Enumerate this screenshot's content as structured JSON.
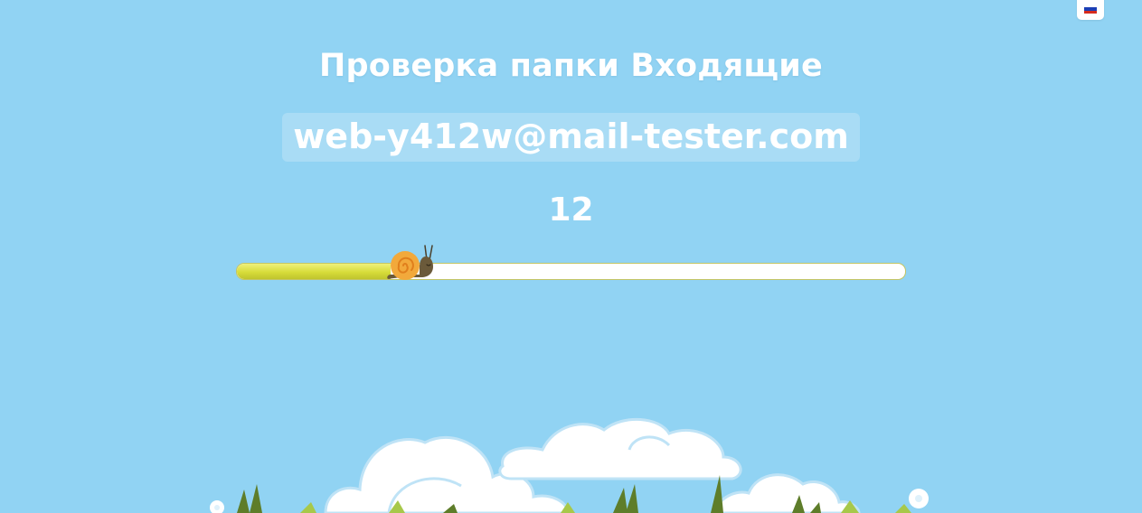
{
  "header": {
    "language": "ru",
    "flag_icon": "russia-flag-icon"
  },
  "main": {
    "title": "Проверка папки Входящие",
    "email": "web-y412w@mail-tester.com",
    "countdown": "12",
    "progress_fraction": 0.23
  },
  "colors": {
    "background": "#91d3f3",
    "progress_fill": "#d7dc3a",
    "snail_shell": "#f2a93b",
    "snail_body": "#6b5a3a"
  }
}
